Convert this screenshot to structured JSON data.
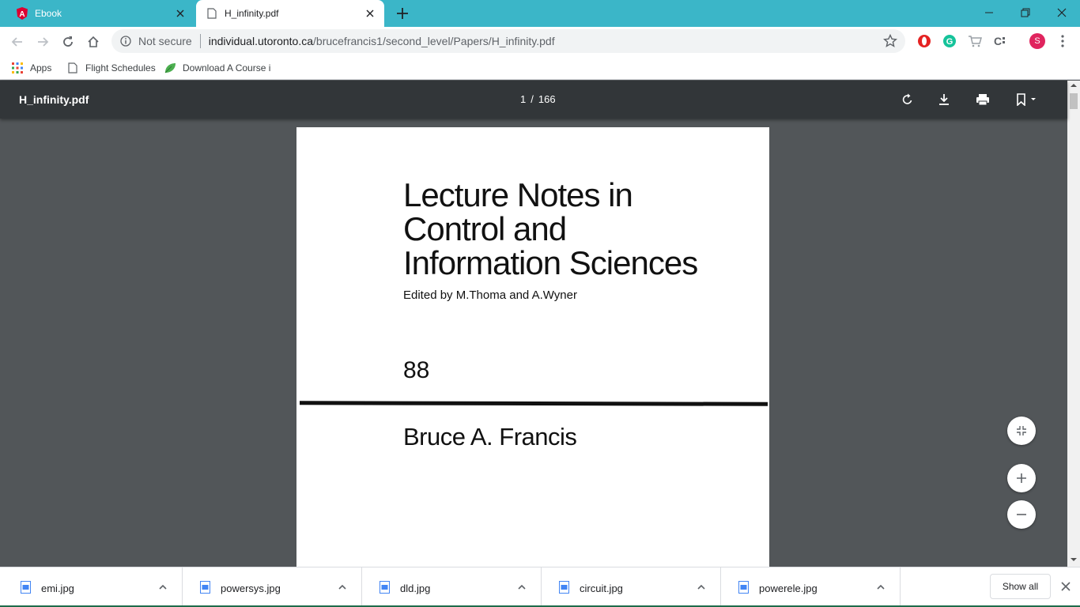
{
  "browser": {
    "tabs": [
      {
        "title": "Ebook",
        "icon": "angular-logo-icon",
        "active": false
      },
      {
        "title": "H_infinity.pdf",
        "icon": "document-icon",
        "active": true
      }
    ],
    "accent_color": "#3bb6c8"
  },
  "toolbar": {
    "security_text": "Not secure",
    "url_host": "individual.utoronto.ca",
    "url_path": "/brucefrancis1/second_level/Papers/H_infinity.pdf",
    "profile_initial": "S"
  },
  "bookmarks": [
    {
      "label": "Apps",
      "icon": "apps-grid-icon"
    },
    {
      "label": "Flight Schedules",
      "icon": "page-icon"
    },
    {
      "label": "Download A Course i",
      "icon": "leaf-icon"
    }
  ],
  "pdf": {
    "filename": "H_infinity.pdf",
    "current_page": "1",
    "page_separator": "/",
    "total_pages": "166",
    "document": {
      "series_line1": "Lecture Notes in",
      "series_line2": "Control and",
      "series_line3": "Information Sciences",
      "editors": "Edited by M.Thoma and A.Wyner",
      "volume": "88",
      "author": "Bruce A. Francis"
    }
  },
  "downloads": [
    {
      "filename": "emi.jpg"
    },
    {
      "filename": "powersys.jpg"
    },
    {
      "filename": "dld.jpg"
    },
    {
      "filename": "circuit.jpg"
    },
    {
      "filename": "powerele.jpg"
    }
  ],
  "shelf": {
    "show_all_label": "Show all"
  }
}
